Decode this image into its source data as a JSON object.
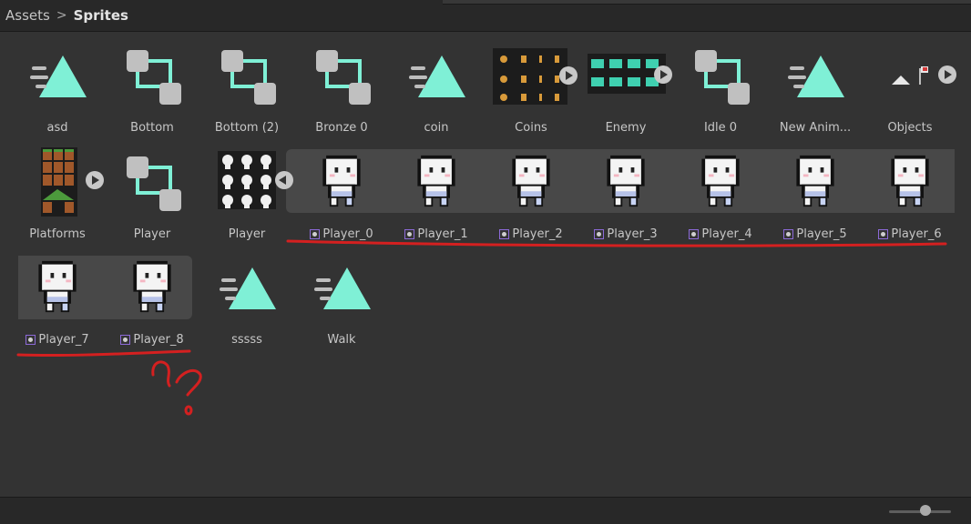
{
  "breadcrumb": {
    "parent": "Assets",
    "separator": ">",
    "current": "Sprites"
  },
  "assets": [
    {
      "label": "asd",
      "icon": "animation-clip-icon"
    },
    {
      "label": "Bottom",
      "icon": "animator-controller-icon"
    },
    {
      "label": "Bottom (2)",
      "icon": "animator-controller-icon"
    },
    {
      "label": "Bronze 0",
      "icon": "animator-controller-icon"
    },
    {
      "label": "coin",
      "icon": "animation-clip-icon"
    },
    {
      "label": "Coins",
      "icon": "sprite-sheet-icon"
    },
    {
      "label": "Enemy",
      "icon": "sprite-sheet-icon"
    },
    {
      "label": "Idle 0",
      "icon": "animator-controller-icon"
    },
    {
      "label": "New Anim...",
      "icon": "animation-clip-icon"
    },
    {
      "label": "Objects",
      "icon": "sprite-sheet-icon"
    },
    {
      "label": "Platforms",
      "icon": "sprite-sheet-icon"
    },
    {
      "label": "Player",
      "icon": "animator-controller-icon"
    },
    {
      "label": "Player",
      "icon": "sprite-sheet-icon"
    },
    {
      "label": "sssss",
      "icon": "animation-clip-icon"
    },
    {
      "label": "Walk",
      "icon": "animation-clip-icon"
    }
  ],
  "player_sprites": [
    "Player_0",
    "Player_1",
    "Player_2",
    "Player_3",
    "Player_4",
    "Player_5",
    "Player_6",
    "Player_7",
    "Player_8"
  ],
  "colors": {
    "accent": "#7ff0d6",
    "controller_box": "#c0c0c0",
    "annotation": "#d42020",
    "sub_asset_border": "#8c6ad8"
  }
}
